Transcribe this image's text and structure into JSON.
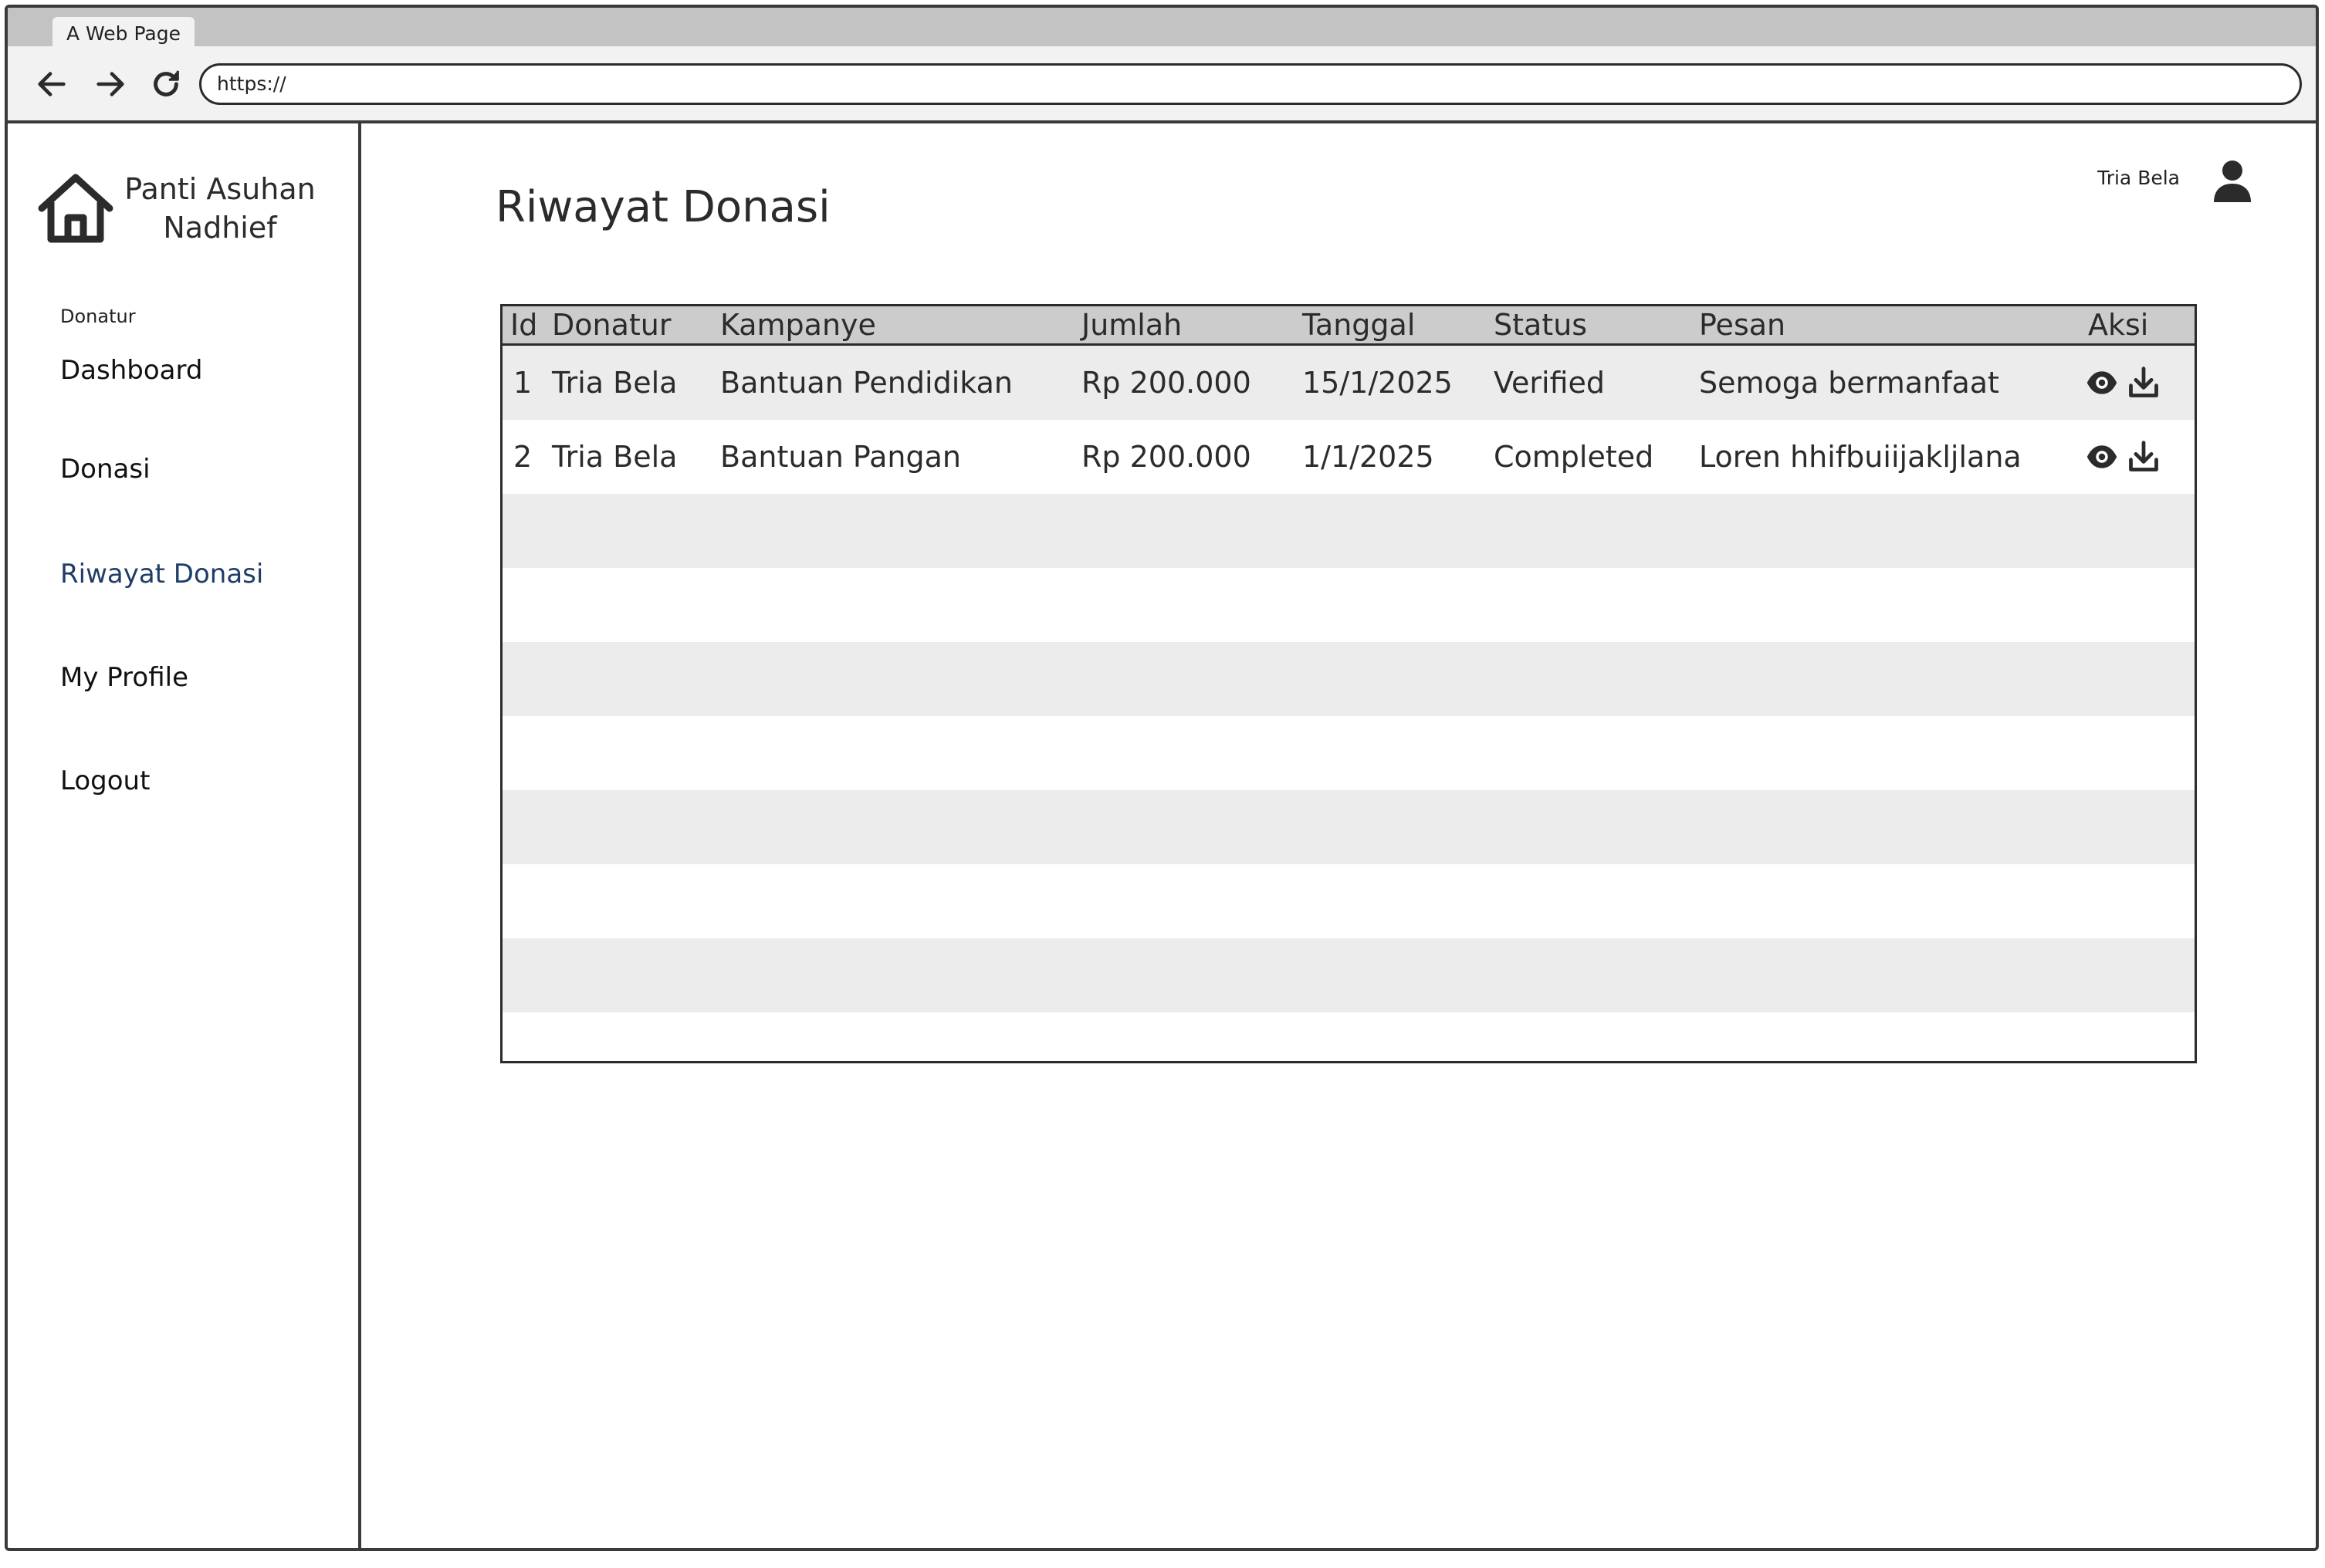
{
  "browser": {
    "tab_title": "A Web Page",
    "url": "https://"
  },
  "sidebar": {
    "brand": "Panti Asuhan Nadhief",
    "role": "Donatur",
    "items": [
      {
        "label": "Dashboard"
      },
      {
        "label": "Donasi"
      },
      {
        "label": "Riwayat Donasi",
        "active": true
      },
      {
        "label": "My Profile"
      },
      {
        "label": "Logout"
      }
    ]
  },
  "header": {
    "title": "Riwayat Donasi",
    "user_name": "Tria Bela"
  },
  "table": {
    "columns": [
      "Id",
      "Donatur",
      "Kampanye",
      "Jumlah",
      "Tanggal",
      "Status",
      "Pesan",
      "Aksi"
    ],
    "rows": [
      [
        "1",
        "Tria Bela",
        "Bantuan Pendidikan",
        "Rp 200.000",
        "15/1/2025",
        "Verified",
        "Semoga bermanfaat"
      ],
      [
        "2",
        "Tria Bela",
        "Bantuan Pangan",
        "Rp 200.000",
        "1/1/2025",
        "Completed",
        "Loren hhifbuiijakljlana"
      ]
    ],
    "row_actions": [
      "eye-icon",
      "download-icon"
    ]
  },
  "colors": {
    "header_bg": "#cccccc",
    "stripe": "#ececec",
    "active_menu": "#1f3d66",
    "chrome": "#c3c3c3"
  }
}
